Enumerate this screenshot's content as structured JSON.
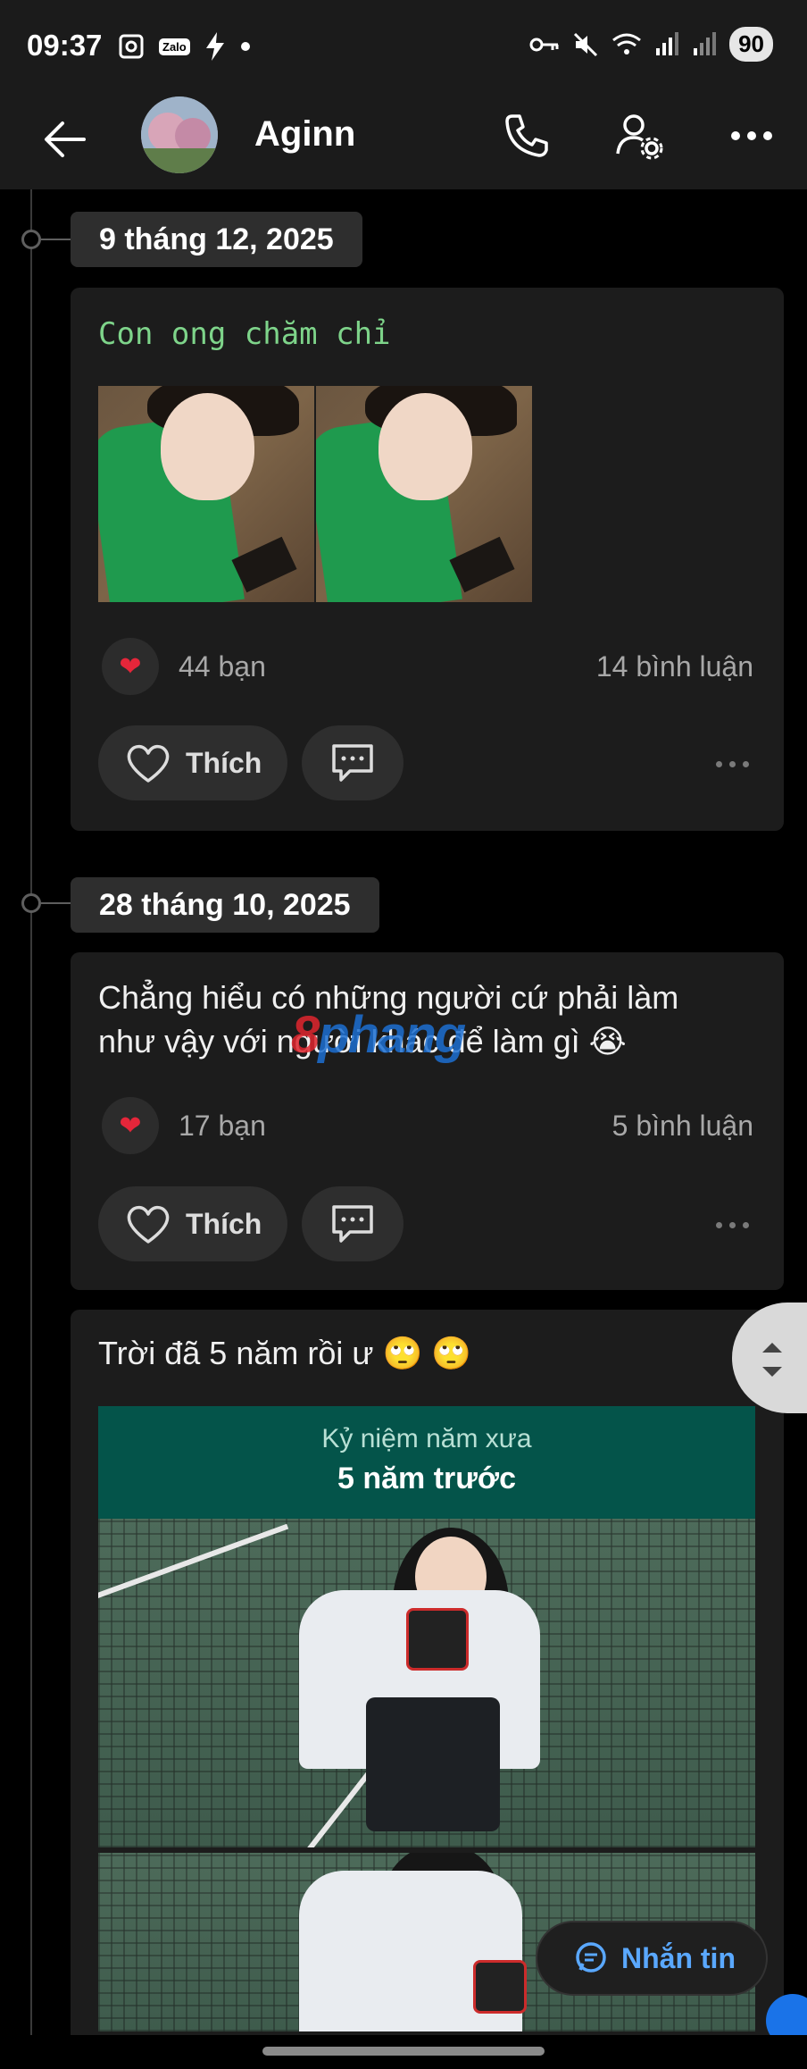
{
  "status_bar": {
    "time": "09:37",
    "zalo_label": "Zalo",
    "battery": "90",
    "icons": [
      "screenshot-icon",
      "zalo-icon",
      "flash-icon",
      "dot-icon",
      "key-icon",
      "mute-icon",
      "wifi-icon",
      "signal-icon",
      "signal-icon-2",
      "battery-icon"
    ]
  },
  "header": {
    "contact_name": "Aginn",
    "icons": [
      "back-arrow-icon",
      "avatar",
      "phone-icon",
      "user-settings-icon",
      "more-icon"
    ]
  },
  "posts": [
    {
      "date": "9 tháng 12, 2025",
      "text": "Con ong chăm chỉ",
      "reactions": "44 bạn",
      "comments": "14 bình luận",
      "like_label": "Thích"
    },
    {
      "date": "28 tháng 10, 2025",
      "text_line1": "Chẳng hiểu có những người cứ phải làm",
      "text_line2": "như vậy với người khác để làm gì 😭",
      "reactions": "17 bạn",
      "comments": "5 bình luận",
      "like_label": "Thích"
    },
    {
      "text": "Trời đã 5 năm rồi ư 🙄 🙄",
      "memory_subtitle": "Kỷ niệm năm xưa",
      "memory_title": "5 năm trước"
    }
  ],
  "watermark": {
    "part1": "8",
    "part2": "phang"
  },
  "message_button": {
    "label": "Nhắn tin"
  }
}
